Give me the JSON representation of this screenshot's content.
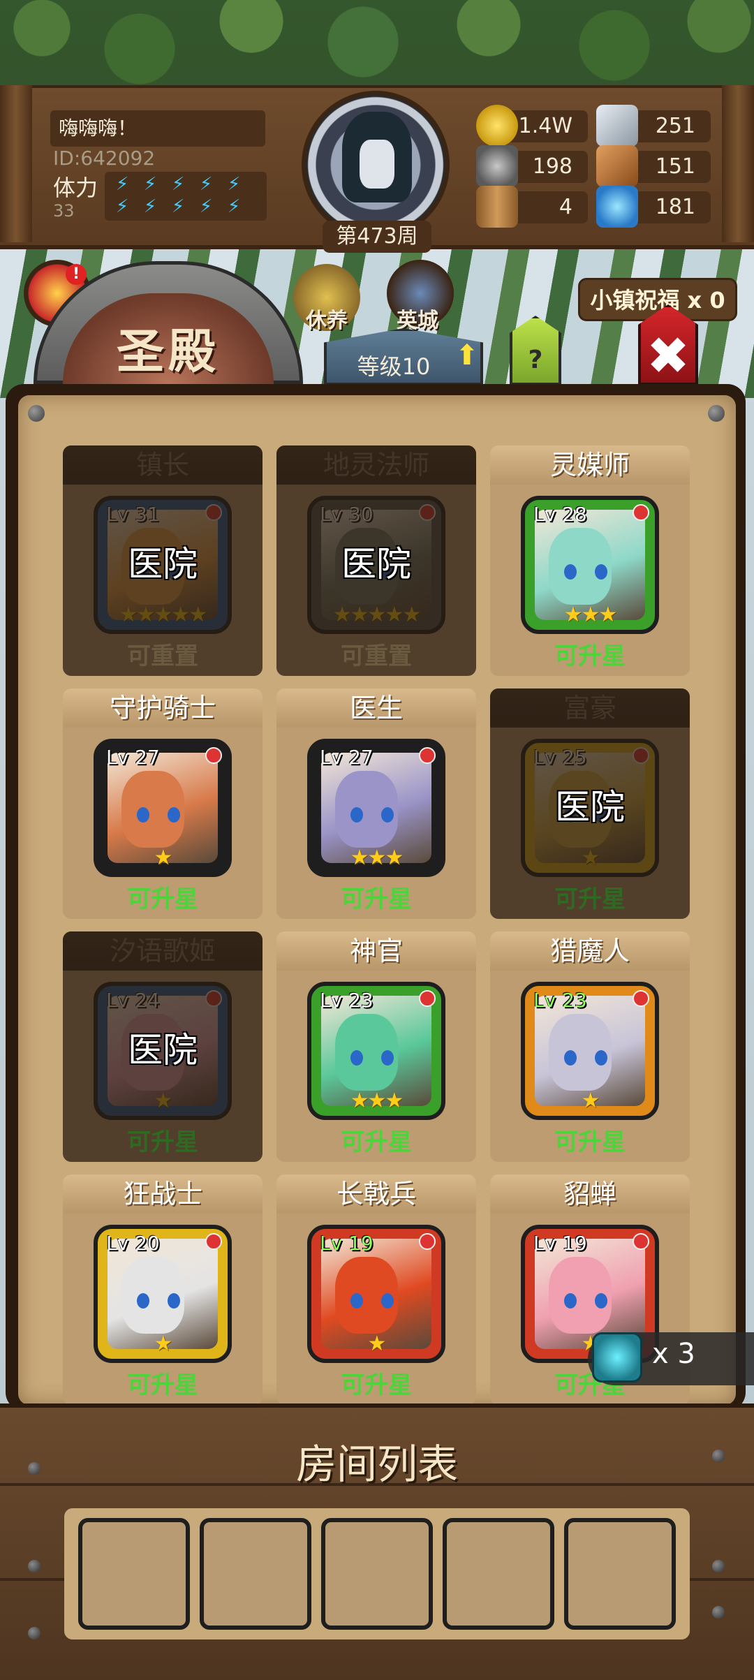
{
  "player": {
    "name": "嗨嗨嗨！",
    "id": "ID:642092",
    "stamina_label": "体力",
    "stamina_value": "33",
    "week": "第473周"
  },
  "resources": {
    "gold": "1.4W",
    "iron": "251",
    "stone": "198",
    "ore": "151",
    "wood": "4",
    "crystal": "181"
  },
  "top_icons": {
    "rest_label": "休养",
    "city_label": "英城"
  },
  "blessing": "小镇祝福 x 0",
  "tab": {
    "title": "圣殿",
    "level": "等级10",
    "help": "?",
    "close": "✖"
  },
  "colors": {
    "frame_blue": "#2a5f9e",
    "frame_gray": "#555555",
    "frame_green": "#3aa02a",
    "frame_orange": "#e08a1a",
    "frame_red": "#d03a22",
    "frame_gold": "#e0b51a",
    "status_green": "#4cd43a"
  },
  "heroes": [
    {
      "title": "镇长",
      "level": "Lv 31",
      "stars": "★★★★★",
      "overlay": "医院",
      "status": "可重置",
      "dim": true,
      "frame": "#2a5f9e",
      "art": "#e6a04a"
    },
    {
      "title": "地灵法师",
      "level": "Lv 30",
      "stars": "★★★★★",
      "overlay": "医院",
      "status": "可重置",
      "dim": true,
      "frame": "#555555",
      "art": "#6e7a6a"
    },
    {
      "title": "灵媒师",
      "level": "Lv 28",
      "stars": "★★★",
      "overlay": "",
      "status": "可升星",
      "dim": false,
      "frame": "#3aa02a",
      "art": "#8ed8c8"
    },
    {
      "title": "守护骑士",
      "level": "Lv 27",
      "stars": "★",
      "overlay": "",
      "status": "可升星",
      "dim": false,
      "frame": "#1e1e1e",
      "art": "#d87a4a"
    },
    {
      "title": "医生",
      "level": "Lv 27",
      "stars": "★★★",
      "overlay": "",
      "status": "可升星",
      "dim": false,
      "frame": "#1e1e1e",
      "art": "#9a94c8"
    },
    {
      "title": "富豪",
      "level": "Lv 25",
      "stars": "★",
      "overlay": "医院",
      "status": "可升星",
      "dim": true,
      "frame": "#e0b51a",
      "art": "#d8b04a"
    },
    {
      "title": "汐语歌姬",
      "level": "Lv 24",
      "stars": "★",
      "overlay": "医院",
      "status": "可升星",
      "dim": true,
      "frame": "#2a5f9e",
      "art": "#e6a2b8"
    },
    {
      "title": "神官",
      "level": "Lv 23",
      "stars": "★★★",
      "overlay": "",
      "status": "可升星",
      "dim": false,
      "frame": "#3aa02a",
      "art": "#5ac89a"
    },
    {
      "title": "猎魔人",
      "level": "Lv 23",
      "stars": "★",
      "overlay": "",
      "status": "可升星",
      "dim": false,
      "frame": "#e08a1a",
      "art": "#c8c4d8",
      "lv_green": true
    },
    {
      "title": "狂战士",
      "level": "Lv 20",
      "stars": "★",
      "overlay": "",
      "status": "可升星",
      "dim": false,
      "frame": "#e0b51a",
      "art": "#e4e4e4"
    },
    {
      "title": "长戟兵",
      "level": "Lv 19",
      "stars": "★",
      "overlay": "",
      "status": "可升星",
      "dim": false,
      "frame": "#d03a22",
      "art": "#e04a22",
      "lv_green": true
    },
    {
      "title": "貂蝉",
      "level": "Lv 19",
      "stars": "★",
      "overlay": "",
      "status": "可升星",
      "dim": false,
      "frame": "#d03a22",
      "art": "#f0a0b0"
    }
  ],
  "ticket": "x 3",
  "rooms": {
    "title": "房间列表",
    "slots": [
      "",
      "",
      "",
      "",
      ""
    ]
  }
}
